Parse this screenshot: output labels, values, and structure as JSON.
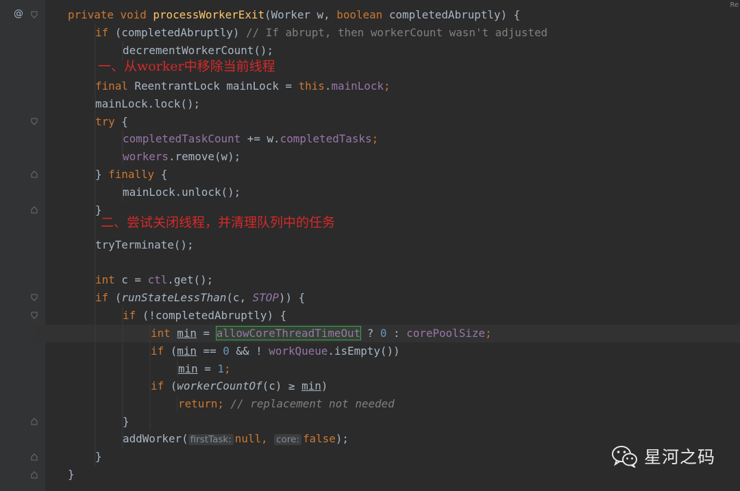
{
  "editor": {
    "gutter_marker": "@",
    "top_right_label": "Re",
    "lines": {
      "l1": {
        "a": "private void ",
        "b": "processWorkerExit",
        "c": "(Worker w, ",
        "d": "boolean ",
        "e": "completedAbruptly) {"
      },
      "l2": {
        "a": "if ",
        "b": "(completedAbruptly) ",
        "c": "// If abrupt, then workerCount wasn't adjusted"
      },
      "l3": {
        "a": "decrementWorkerCount();"
      },
      "l5": {
        "a": "final ",
        "b": "ReentrantLock mainLock = ",
        "c": "this",
        ".": ".",
        "d": "mainLock",
        ";": ";"
      },
      "l6": {
        "a": "mainLock.lock();"
      },
      "l7": {
        "a": "try ",
        "b": "{"
      },
      "l8": {
        "a": "completedTaskCount ",
        "b": "+= w.",
        "c": "completedTasks",
        "d": ";"
      },
      "l9": {
        "a": "workers",
        ".": ".remove(w);"
      },
      "l10": {
        "a": "} ",
        "b": "finally ",
        "c": "{"
      },
      "l11": {
        "a": "mainLock.unlock();"
      },
      "l12": {
        "a": "}"
      },
      "l14": {
        "a": "tryTerminate();"
      },
      "l16": {
        "a": "int ",
        "b": "c = ",
        "c": "ctl",
        ".": ".get();"
      },
      "l17": {
        "a": "if ",
        "b": "(",
        "c": "runStateLessThan",
        "d": "(c, ",
        "e": "STOP",
        "f": ")) {"
      },
      "l18": {
        "a": "if ",
        "b": "(!completedAbruptly) {"
      },
      "l19": {
        "a": "int ",
        "b": "min",
        " = ": " = ",
        "c": "allowCoreThreadTimeOut",
        "d": " ? ",
        "e": "0",
        " : ": " : ",
        "f": "corePoolSize",
        ";": ";"
      },
      "l20": {
        "a": "if ",
        "b": "(",
        "c": "min",
        " == ": " == ",
        "d": "0",
        " && ": " && ! ",
        "e": "workQueue",
        "f": ".isEmpty())"
      },
      "l21": {
        "a": "min",
        " = ": " = ",
        "b": "1",
        ";": ";"
      },
      "l22": {
        "a": "if ",
        "b": "(",
        "c": "workerCountOf",
        "d": "(c) ≥ ",
        "e": "min",
        ")": ")"
      },
      "l23": {
        "a": "return",
        "b": "; ",
        "c": "// replacement not needed"
      },
      "l24": {
        "a": "}"
      },
      "l25": {
        "a": "addWorker(",
        "h1": "firstTask:",
        "b": "null",
        ",": ", ",
        "h2": "core:",
        "c": "false",
        ")": ");"
      },
      "l26": {
        "a": "}"
      },
      "l27": {
        "a": "}"
      }
    }
  },
  "annotations": {
    "first": "一、从worker中移除当前线程",
    "second": "二、尝试关闭线程，并清理队列中的任务"
  },
  "watermark": {
    "text": "星河之码",
    "icon": "wechat-icon"
  },
  "colors": {
    "keyword": "#cc7832",
    "method_decl": "#ffc66d",
    "field": "#9876aa",
    "number": "#6897bb",
    "comment": "#808080",
    "annotation": "#d42a2a"
  }
}
